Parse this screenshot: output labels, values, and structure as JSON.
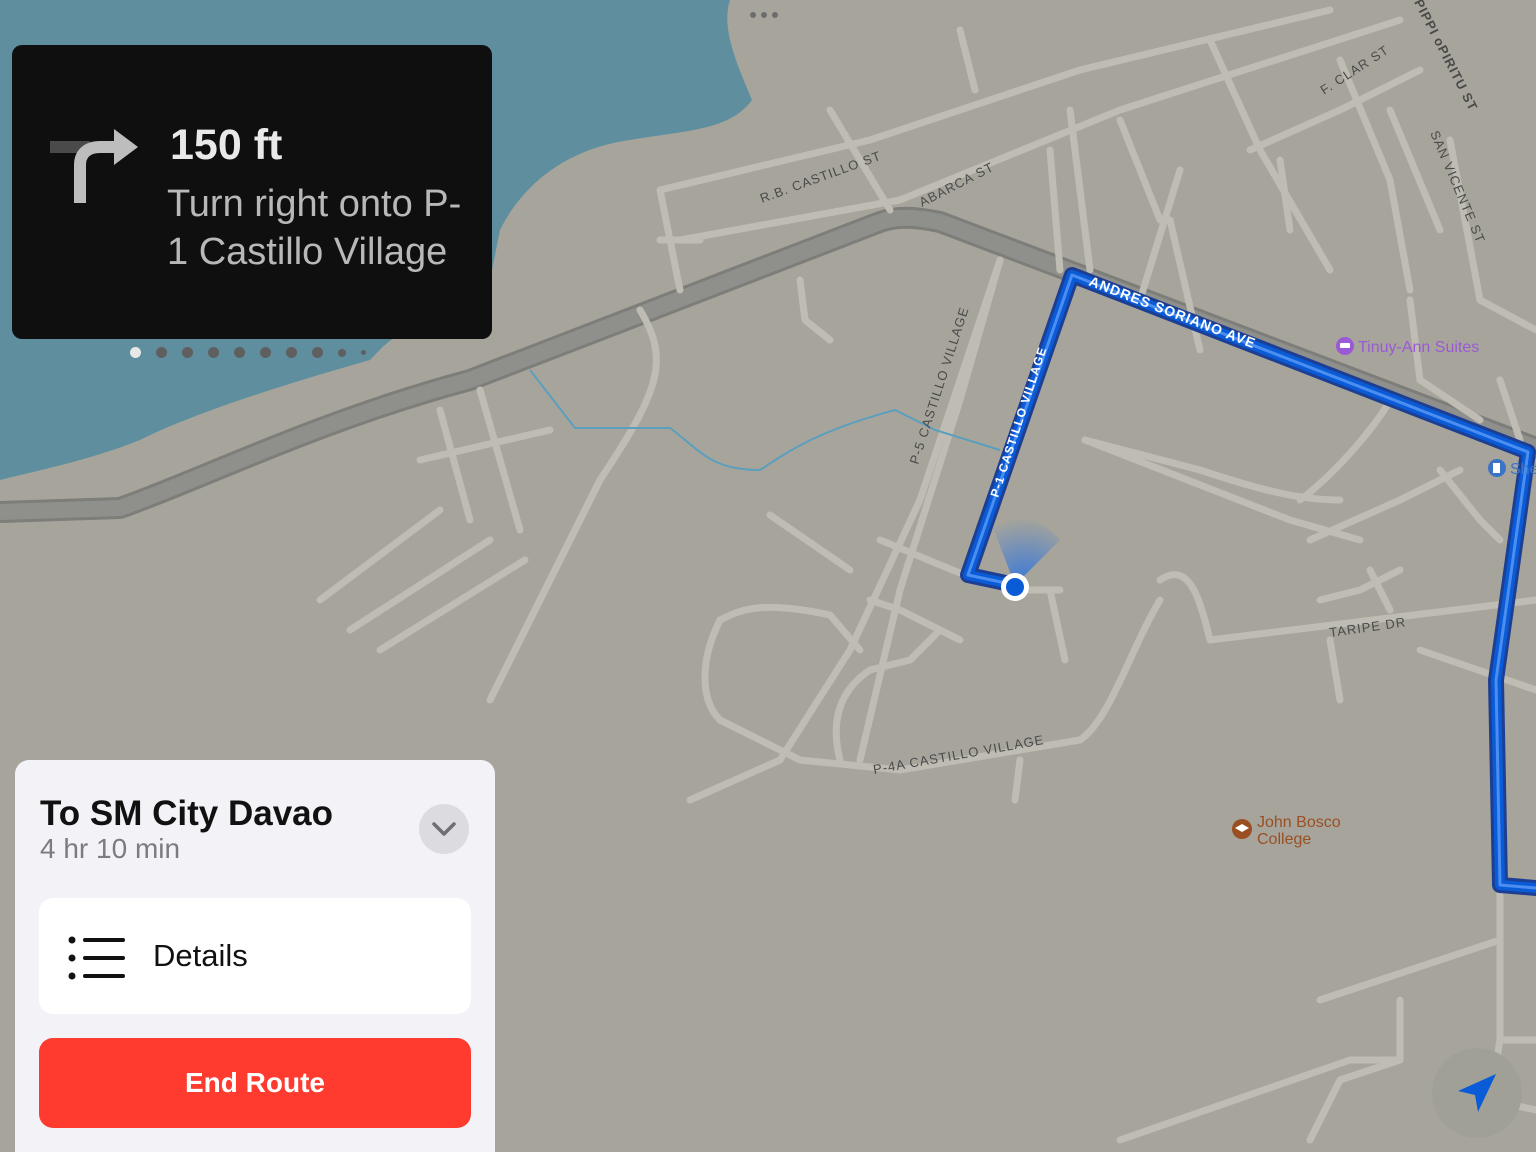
{
  "navigation": {
    "distance": "150 ft",
    "instruction": "Turn right onto P-1 Castillo Village",
    "turn_icon": "turn-right-arrow-icon",
    "step_count": 10,
    "active_step": 1
  },
  "map": {
    "streets": {
      "rb_castillo": "R.B. CASTILLO ST",
      "abarca": "ABARCA ST",
      "andres_soriano": "ANDRES SORIANO AVE",
      "p1_castillo": "P-1 CASTILLO VILLAGE",
      "p5_castillo": "P-5 CASTILLO VILLAGE",
      "p4a_castillo": "P-4A CASTILLO VILLAGE",
      "taripe": "TARIPE DR",
      "f_clar": "F. CLAR ST",
      "san_vicente": "SAN VICENTE ST",
      "spiritu": "PIPPI oPIRITU ST"
    },
    "pois": {
      "hotel": "Tinuy-Ann Suites",
      "hotel_icon": "bed-icon",
      "gas_partial": "She",
      "gas_icon": "fuel-icon",
      "college_line1": "John Bosco",
      "college_line2": "College",
      "college_icon": "graduation-cap-icon"
    },
    "colors": {
      "land": "#a7a59b",
      "water": "#5f8f9f",
      "road": "#bbb9b2",
      "highway": "#8d8d8b",
      "route": "#0a5bd8",
      "hotel": "#9b59d6",
      "college": "#9a4f22"
    }
  },
  "route_card": {
    "destination": "To SM City Davao",
    "eta": "4 hr 10 min",
    "details_label": "Details",
    "end_label": "End Route",
    "end_color": "#ff3b30"
  },
  "controls": {
    "locate_icon": "location-arrow-icon",
    "collapse_icon": "chevron-down-icon",
    "handle_icon": "more-dots-icon"
  }
}
